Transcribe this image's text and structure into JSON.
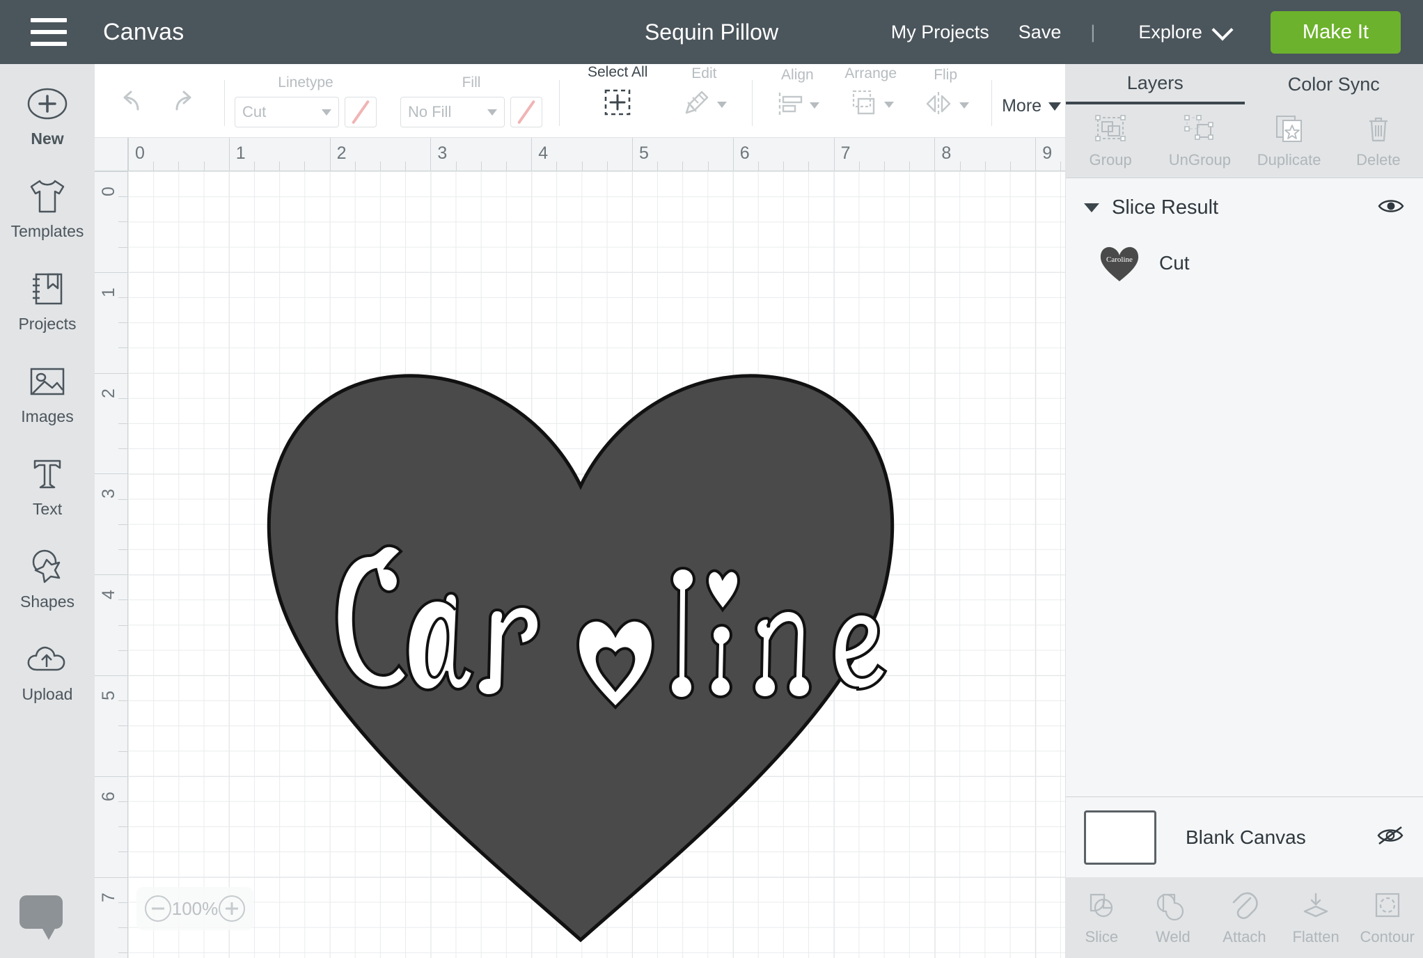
{
  "header": {
    "menu_icon": "hamburger-icon",
    "canvas_label": "Canvas",
    "project_title": "Sequin Pillow",
    "my_projects": "My Projects",
    "save": "Save",
    "divider": "|",
    "explore": "Explore",
    "make_it": "Make It",
    "accent_green": "#6cb22c",
    "bar_color": "#4b555c"
  },
  "sidebar": {
    "items": [
      {
        "label": "New",
        "icon": "plus-circle-icon"
      },
      {
        "label": "Templates",
        "icon": "tshirt-icon"
      },
      {
        "label": "Projects",
        "icon": "notebook-bookmark-icon"
      },
      {
        "label": "Images",
        "icon": "picture-icon"
      },
      {
        "label": "Text",
        "icon": "text-t-icon"
      },
      {
        "label": "Shapes",
        "icon": "shapes-star-circle-icon"
      },
      {
        "label": "Upload",
        "icon": "cloud-upload-icon"
      }
    ],
    "help_chat": "chat-bubble-icon"
  },
  "toolbar": {
    "undo": "undo-icon",
    "redo": "redo-icon",
    "linetype_label": "Linetype",
    "linetype_value": "Cut",
    "fill_label": "Fill",
    "fill_value": "No Fill",
    "select_all_label": "Select All",
    "select_all_icon": "select-all-icon",
    "edit_label": "Edit",
    "edit_icon": "edit-pencil-icon",
    "align_label": "Align",
    "align_icon": "align-icon",
    "arrange_label": "Arrange",
    "arrange_icon": "arrange-layers-icon",
    "flip_label": "Flip",
    "flip_icon": "flip-icon",
    "more_label": "More"
  },
  "canvas": {
    "ruler_h_ticks": [
      "0",
      "1",
      "2",
      "3",
      "4",
      "5",
      "6",
      "7",
      "8",
      "9"
    ],
    "ruler_v_ticks": [
      "0",
      "1",
      "2",
      "3",
      "4",
      "5",
      "6",
      "7"
    ],
    "zoom_level": "100%",
    "zoom_out_icon": "minus-circle-icon",
    "zoom_in_icon": "plus-circle-icon",
    "shape_name": "heart-shape",
    "shape_fill": "#4a4a4a",
    "shape_stroke": "#0d0d0d",
    "text_on_shape": "Caroline",
    "text_fill": "#ffffff"
  },
  "right_panel": {
    "tabs": [
      {
        "label": "Layers",
        "active": true
      },
      {
        "label": "Color Sync",
        "active": false
      }
    ],
    "tools": [
      {
        "label": "Group",
        "icon": "group-icon"
      },
      {
        "label": "UnGroup",
        "icon": "ungroup-icon"
      },
      {
        "label": "Duplicate",
        "icon": "duplicate-icon"
      },
      {
        "label": "Delete",
        "icon": "trash-icon"
      }
    ],
    "layer_group": {
      "name": "Slice Result",
      "visibility_icon": "eye-visible-icon",
      "expanded": true
    },
    "layers": [
      {
        "label": "Cut",
        "thumb": "heart-caroline-thumb"
      }
    ],
    "canvas_layer": {
      "label": "Blank Canvas",
      "visibility_icon": "eye-hidden-icon"
    },
    "bottom_tools": [
      {
        "label": "Slice",
        "icon": "slice-icon"
      },
      {
        "label": "Weld",
        "icon": "weld-icon"
      },
      {
        "label": "Attach",
        "icon": "paperclip-icon"
      },
      {
        "label": "Flatten",
        "icon": "flatten-icon"
      },
      {
        "label": "Contour",
        "icon": "contour-icon"
      }
    ]
  }
}
